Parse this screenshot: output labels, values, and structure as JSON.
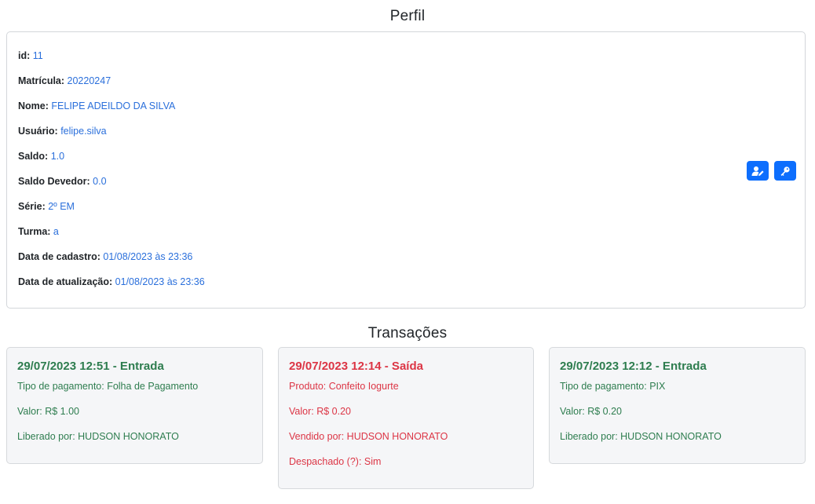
{
  "profile": {
    "title": "Perfil",
    "fields": [
      {
        "label": "id:",
        "value": "11"
      },
      {
        "label": "Matrícula:",
        "value": "20220247"
      },
      {
        "label": "Nome:",
        "value": "FELIPE ADEILDO DA SILVA"
      },
      {
        "label": "Usuário:",
        "value": "felipe.silva"
      },
      {
        "label": "Saldo:",
        "value": "1.0"
      },
      {
        "label": "Saldo Devedor:",
        "value": "0.0"
      },
      {
        "label": "Série:",
        "value": "2º EM"
      },
      {
        "label": "Turma:",
        "value": "a"
      },
      {
        "label": "Data de cadastro:",
        "value": "01/08/2023 às 23:36"
      },
      {
        "label": "Data de atualização:",
        "value": "01/08/2023 às 23:36"
      }
    ],
    "actions": {
      "edit_icon": "user-edit-icon",
      "password_icon": "key-icon"
    }
  },
  "transactions": {
    "title": "Transações",
    "items": [
      {
        "heading": "29/07/2023 12:51 - Entrada",
        "type": "entrada",
        "color": "#2e7d4f",
        "lines": [
          "Tipo de pagamento: Folha de Pagamento",
          "Valor: R$ 1.00",
          "Liberado por: HUDSON HONORATO"
        ]
      },
      {
        "heading": "29/07/2023 12:14 - Saída",
        "type": "saida",
        "color": "#dc3545",
        "lines": [
          "Produto: Confeito Iogurte",
          "Valor: R$ 0.20",
          "Vendido por: HUDSON HONORATO",
          "Despachado (?): Sim"
        ]
      },
      {
        "heading": "29/07/2023 12:12 - Entrada",
        "type": "entrada",
        "color": "#2e7d4f",
        "lines": [
          "Tipo de pagamento: PIX",
          "Valor: R$ 0.20",
          "Liberado por: HUDSON HONORATO"
        ]
      }
    ]
  }
}
